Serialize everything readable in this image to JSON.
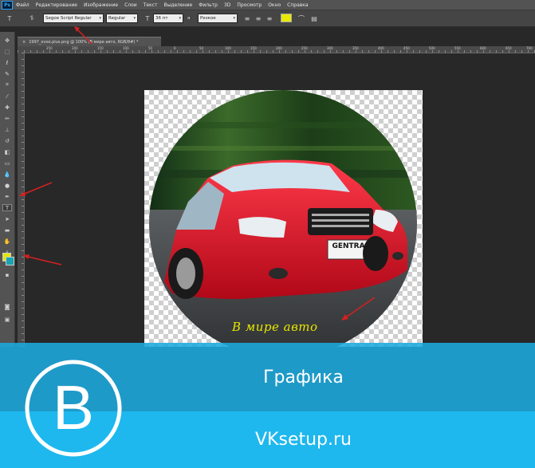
{
  "app": {
    "logo": "Ps",
    "menu": [
      "Файл",
      "Редактирование",
      "Изображение",
      "Слои",
      "Текст",
      "Выделение",
      "Фильтр",
      "3D",
      "Просмотр",
      "Окно",
      "Справка"
    ]
  },
  "options_bar": {
    "tool_icon": "text-tool-icon",
    "font_family": "Segoe Script Regular",
    "font_style": "Regular",
    "font_size": "36 пт",
    "antialias_label": "a",
    "antialias": "Резкое",
    "text_color": "#e8e800"
  },
  "document": {
    "tab_title": "1997_ovoo.plus.png @ 100% (В мире авто, RGB/8#) *",
    "ruler_ticks": [
      "250",
      "200",
      "150",
      "100",
      "50",
      "0",
      "50",
      "100",
      "150",
      "200",
      "250",
      "300",
      "350",
      "400",
      "450",
      "500",
      "550",
      "600",
      "650",
      "700"
    ],
    "layer_text": "В мире авто",
    "car_plate": "GENTRA"
  },
  "overlay": {
    "title": "Графика",
    "site": "VKsetup.ru",
    "logo_letter": "B"
  },
  "colors": {
    "foreground": "#e6e600",
    "background": "#1aa3b0",
    "band": "#1eb8ee",
    "annotation_arrow": "#d42020"
  }
}
